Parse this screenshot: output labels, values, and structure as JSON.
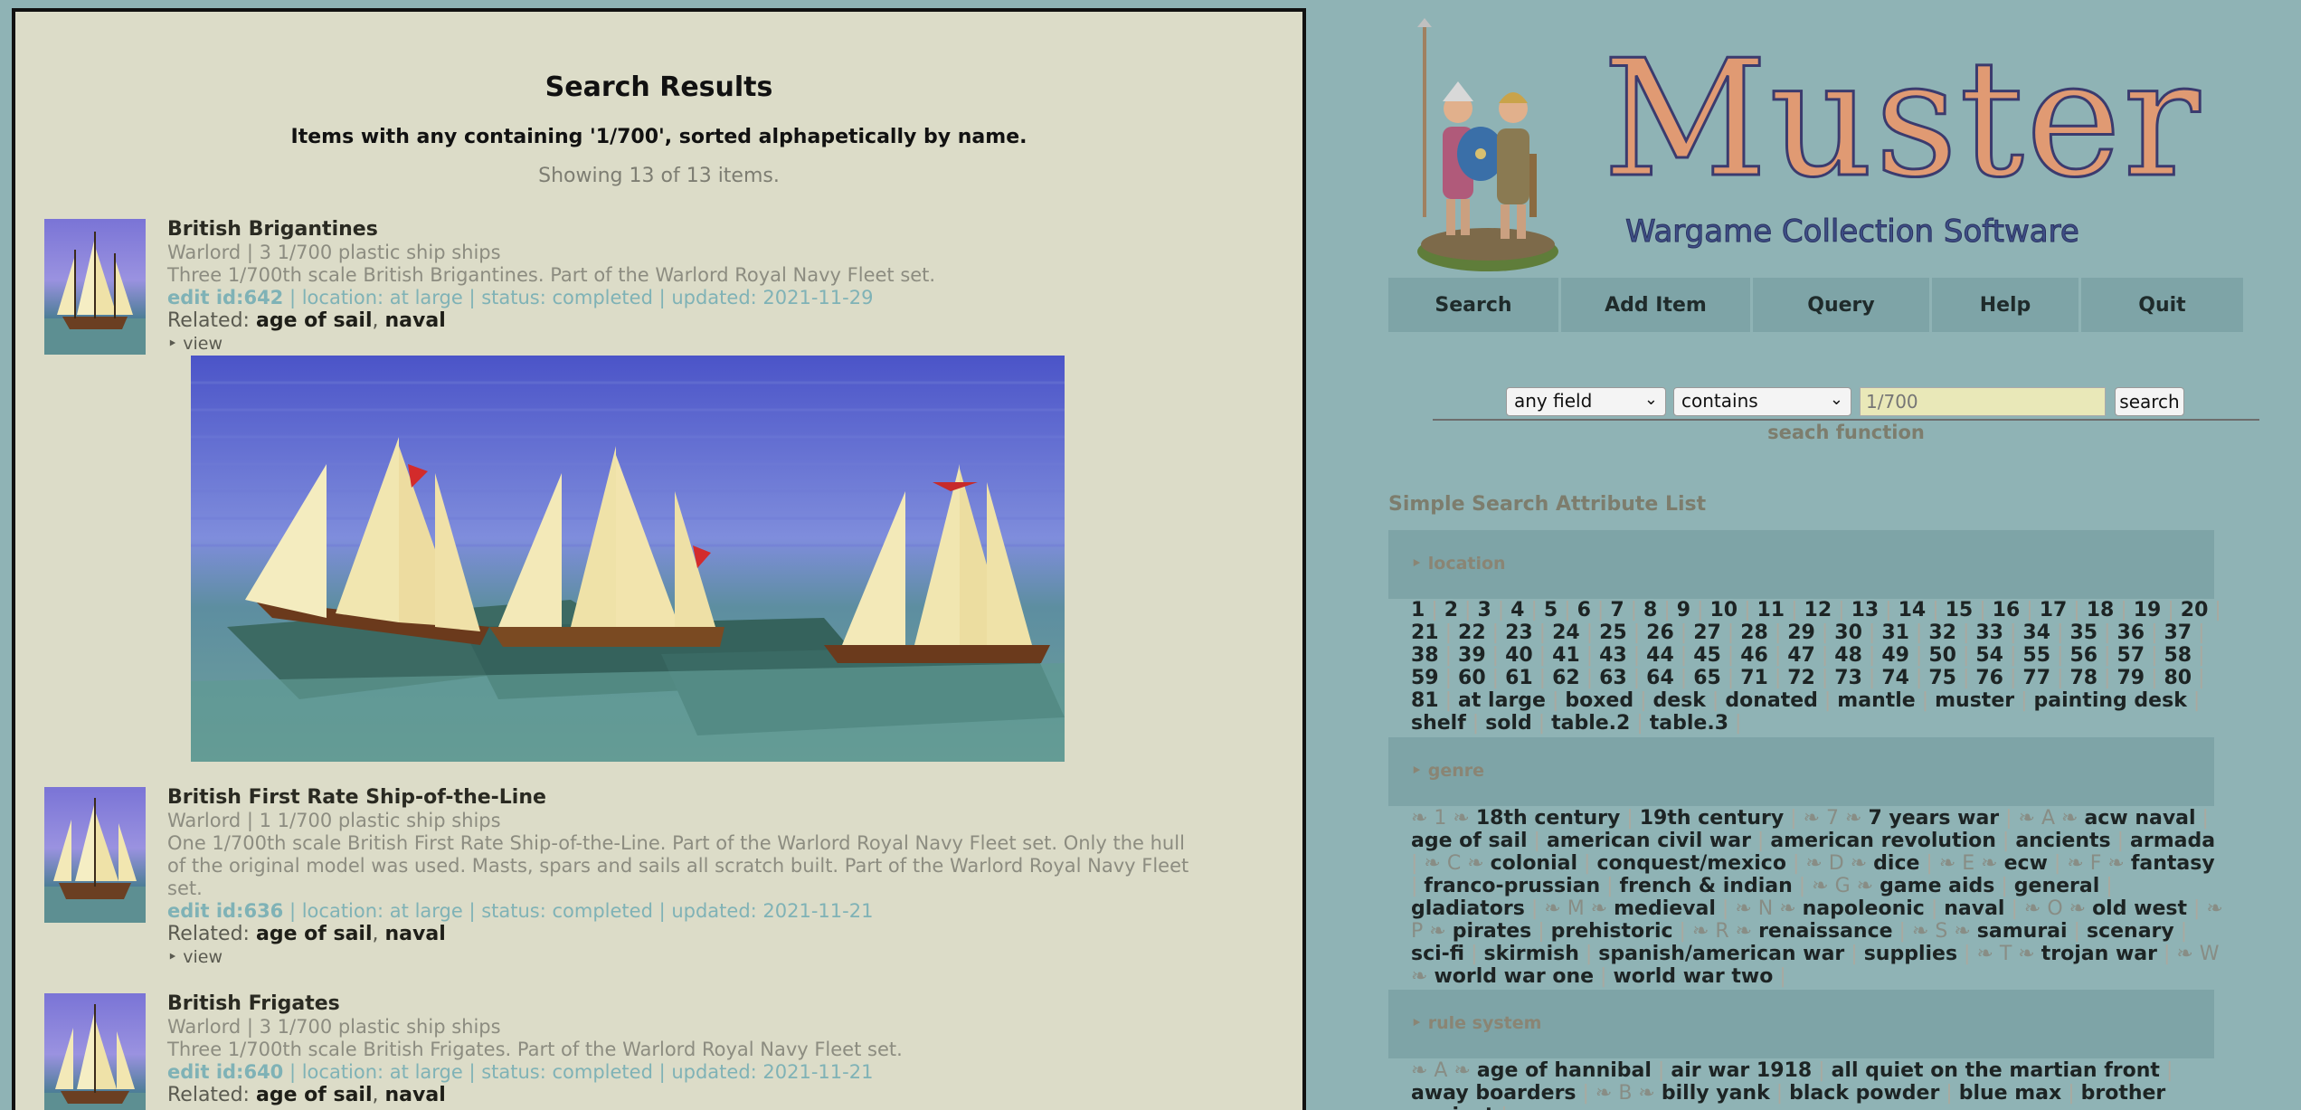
{
  "results": {
    "title": "Search Results",
    "subtitle": "Items with any containing '1/700', sorted alphapetically by name.",
    "showing": "Showing 13 of 13 items.",
    "related_label": "Related:",
    "view_label": "‣ view",
    "items": [
      {
        "name": "British Brigantines",
        "meta": "Warlord | 3 1/700 plastic ship ships",
        "description": "Three 1/700th scale British Brigantines. Part of the Warlord Royal Navy Fleet set.",
        "edit_id": "edit id:642",
        "details": " | location: at large | status: completed | updated: 2021-11-29",
        "related": [
          "age of sail",
          "naval"
        ]
      },
      {
        "name": "British First Rate Ship-of-the-Line",
        "meta": "Warlord | 1 1/700 plastic ship ships",
        "description": "One 1/700th scale British First Rate Ship-of-the-Line. Part of the Warlord Royal Navy Fleet set. Only the hull of the original model was used. Masts, spars and sails all scratch built. Part of the Warlord Royal Navy Fleet set.",
        "edit_id": "edit id:636",
        "details": " | location: at large | status: completed | updated: 2021-11-21",
        "related": [
          "age of sail",
          "naval"
        ]
      },
      {
        "name": "British Frigates",
        "meta": "Warlord | 3 1/700 plastic ship ships",
        "description": "Three 1/700th scale British Frigates. Part of the Warlord Royal Navy Fleet set.",
        "edit_id": "edit id:640",
        "details": " | location: at large | status: completed | updated: 2021-11-21",
        "related": [
          "age of sail",
          "naval"
        ]
      }
    ]
  },
  "header": {
    "logo_title": "Muster",
    "logo_subtitle": "Wargame Collection Software"
  },
  "nav": [
    "Search",
    "Add Item",
    "Query",
    "Help",
    "Quit"
  ],
  "search": {
    "field_value": "any field",
    "operator_value": "contains",
    "placeholder": "1/700",
    "button_label": "search",
    "caption": "seach function"
  },
  "attributes": {
    "heading": "Simple Search Attribute List",
    "sections": [
      {
        "label": "‣ location",
        "entries": [
          "1",
          "2",
          "3",
          "4",
          "5",
          "6",
          "7",
          "8",
          "9",
          "10",
          "11",
          "12",
          "13",
          "14",
          "15",
          "16",
          "17",
          "18",
          "19",
          "20",
          "21",
          "22",
          "23",
          "24",
          "25",
          "26",
          "27",
          "28",
          "29",
          "30",
          "31",
          "32",
          "33",
          "34",
          "35",
          "36",
          "37",
          "38",
          "39",
          "40",
          "41",
          "43",
          "44",
          "45",
          "46",
          "47",
          "48",
          "49",
          "50",
          "54",
          "55",
          "56",
          "57",
          "58",
          "59",
          "60",
          "61",
          "62",
          "63",
          "64",
          "65",
          "71",
          "72",
          "73",
          "74",
          "75",
          "76",
          "77",
          "78",
          "79",
          "80",
          "81",
          "at large",
          "boxed",
          "desk",
          "donated",
          "mantle",
          "muster",
          "painting desk",
          "shelf",
          "sold",
          "table.2",
          "table.3"
        ]
      },
      {
        "label": "‣ genre",
        "entries": [
          "❧ 1 ❧",
          "18th century",
          "19th century",
          "❧ 7 ❧",
          "7 years war",
          "❧ A ❧",
          "acw naval",
          "age of sail",
          "american civil war",
          "american revolution",
          "ancients",
          "armada",
          "❧ C ❧",
          "colonial",
          "conquest/mexico",
          "❧ D ❧",
          "dice",
          "❧ E ❧",
          "ecw",
          "❧ F ❧",
          "fantasy",
          "franco-prussian",
          "french & indian",
          "❧ G ❧",
          "game aids",
          "general",
          "gladiators",
          "❧ M ❧",
          "medieval",
          "❧ N ❧",
          "napoleonic",
          "naval",
          "❧ O ❧",
          "old west",
          "❧ P ❧",
          "pirates",
          "prehistoric",
          "❧ R ❧",
          "renaissance",
          "❧ S ❧",
          "samurai",
          "scenary",
          "sci-fi",
          "skirmish",
          "spanish/american war",
          "supplies",
          "❧ T ❧",
          "trojan war",
          "❧ W ❧",
          "world war one",
          "world war two"
        ]
      },
      {
        "label": "‣ rule system",
        "entries": [
          "❧ A ❧",
          "age of hannibal",
          "air war 1918",
          "all quiet on the martian front",
          "away boarders",
          "❧ B ❧",
          "billy yank",
          "black powder",
          "blue max",
          "brother against"
        ]
      }
    ]
  }
}
